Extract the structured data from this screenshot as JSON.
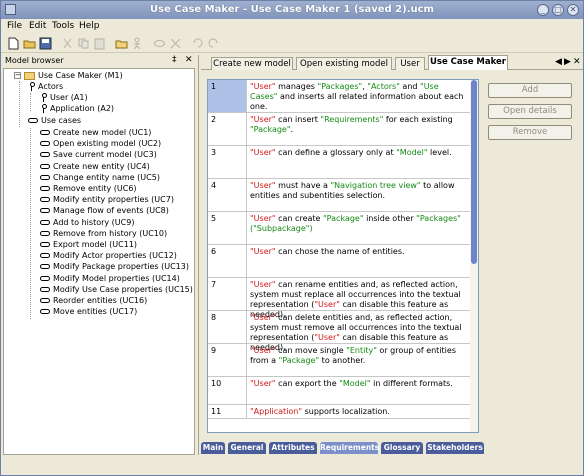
{
  "window": {
    "title": "Use Case Maker - Use Case Maker 1 (saved 2).ucm"
  },
  "menu": [
    {
      "label": "File",
      "mnemonic": "F"
    },
    {
      "label": "Edit",
      "mnemonic": "E"
    },
    {
      "label": "Tools",
      "mnemonic": "T"
    },
    {
      "label": "Help",
      "mnemonic": "H"
    }
  ],
  "toolbar": {
    "icons": [
      "new-icon",
      "open-icon",
      "save-icon",
      "cut-icon",
      "copy-icon",
      "paste-icon",
      "add-package-icon",
      "add-actor-icon",
      "add-usecase-icon",
      "remove-icon",
      "undo-icon",
      "redo-icon"
    ]
  },
  "left_panel": {
    "title": "Model browser",
    "pin": "‡",
    "close": "✕"
  },
  "tree": {
    "root": "Use Case Maker (M1)",
    "actors_folder": "Actors",
    "actors": [
      "User (A1)",
      "Application (A2)"
    ],
    "usecases_folder": "Use cases",
    "usecases": [
      "Create new model (UC1)",
      "Open existing model (UC2)",
      "Save current model (UC3)",
      "Create new entity (UC4)",
      "Change entity name (UC5)",
      "Remove entity (UC6)",
      "Modify entity properties (UC7)",
      "Manage flow of events (UC8)",
      "Add to history (UC9)",
      "Remove from history (UC10)",
      "Export model (UC11)",
      "Modify Actor properties (UC12)",
      "Modify Package properties (UC13)",
      "Modify Model properties (UC14)",
      "Modify Use Case properties (UC15)",
      "Reorder entities (UC16)",
      "Move entities (UC17)"
    ]
  },
  "tabs": [
    {
      "label": "Create new model",
      "active": false
    },
    {
      "label": "Open existing model",
      "active": false
    },
    {
      "label": "User",
      "active": false
    },
    {
      "label": "Use Case Maker",
      "active": true
    }
  ],
  "tab_nav": {
    "left": "◀",
    "right": "▶",
    "close": "✕"
  },
  "requirements": [
    {
      "id": "1",
      "parts": [
        [
          "r",
          "\"User\""
        ],
        [
          "k",
          " manages "
        ],
        [
          "g",
          "\"Packages\""
        ],
        [
          "k",
          ", "
        ],
        [
          "g",
          "\"Actors\""
        ],
        [
          "k",
          " and "
        ],
        [
          "g",
          "\"Use Cases\""
        ],
        [
          "k",
          " and inserts all related information about each one."
        ]
      ]
    },
    {
      "id": "2",
      "parts": [
        [
          "r",
          "\"User\""
        ],
        [
          "k",
          " can insert "
        ],
        [
          "g",
          "\"Requirements\""
        ],
        [
          "k",
          " for each existing "
        ],
        [
          "g",
          "\"Package\""
        ],
        [
          "k",
          "."
        ]
      ]
    },
    {
      "id": "3",
      "parts": [
        [
          "r",
          "\"User\""
        ],
        [
          "k",
          " can define a glossary only at "
        ],
        [
          "g",
          "\"Model\""
        ],
        [
          "k",
          " level."
        ]
      ]
    },
    {
      "id": "4",
      "parts": [
        [
          "r",
          "\"User\""
        ],
        [
          "k",
          " must have a "
        ],
        [
          "g",
          "\"Navigation tree view\""
        ],
        [
          "k",
          " to allow entities and subentities selection."
        ]
      ]
    },
    {
      "id": "5",
      "parts": [
        [
          "r",
          "\"User\""
        ],
        [
          "k",
          " can create "
        ],
        [
          "g",
          "\"Package\""
        ],
        [
          "k",
          " inside other "
        ],
        [
          "g",
          "\"Packages\""
        ],
        [
          "k",
          " "
        ],
        [
          "g",
          "(\"Subpackage\")"
        ]
      ]
    },
    {
      "id": "6",
      "parts": [
        [
          "r",
          "\"User\""
        ],
        [
          "k",
          " can chose the name of entities."
        ]
      ]
    },
    {
      "id": "7",
      "parts": [
        [
          "r",
          "\"User\""
        ],
        [
          "k",
          " can rename entities and, as reflected action, system must replace all occurrences into the textual representation ("
        ],
        [
          "r",
          "\"User\""
        ],
        [
          "k",
          " can disable this feature as needed)."
        ]
      ]
    },
    {
      "id": "8",
      "parts": [
        [
          "r",
          "\"User\""
        ],
        [
          "k",
          " can delete entities and, as reflected action, system must remove all occurrences into the textual representation ("
        ],
        [
          "r",
          "\"User\""
        ],
        [
          "k",
          " can disable this feature as needed)."
        ]
      ]
    },
    {
      "id": "9",
      "parts": [
        [
          "r",
          "\"User\""
        ],
        [
          "k",
          " can move single "
        ],
        [
          "g",
          "\"Entity\""
        ],
        [
          "k",
          " or group of entities from a "
        ],
        [
          "g",
          "\"Package\""
        ],
        [
          "k",
          " to another."
        ]
      ]
    },
    {
      "id": "10",
      "parts": [
        [
          "r",
          "\"User\""
        ],
        [
          "k",
          " can export the "
        ],
        [
          "g",
          "\"Model\""
        ],
        [
          "k",
          " in different formats."
        ]
      ]
    },
    {
      "id": "11",
      "parts": [
        [
          "r",
          "\"Application\""
        ],
        [
          "k",
          " supports localization."
        ]
      ]
    }
  ],
  "buttons": {
    "add": "Add",
    "open_details": "Open details",
    "remove": "Remove"
  },
  "bottom_tabs": [
    {
      "label": "Main",
      "active": false
    },
    {
      "label": "General",
      "active": false
    },
    {
      "label": "Attributes",
      "active": false
    },
    {
      "label": "Requirements",
      "active": true
    },
    {
      "label": "Glossary",
      "active": false
    },
    {
      "label": "Stakeholders",
      "active": false
    }
  ],
  "colors": {
    "keyword_red": "#d01818",
    "keyword_green": "#158a15",
    "selection": "#aec1e6",
    "titlebar": "#8597bf"
  }
}
